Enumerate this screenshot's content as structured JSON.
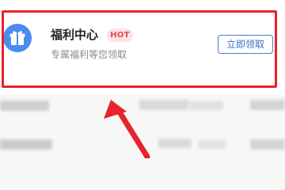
{
  "card": {
    "title": "福利中心",
    "badge": "HOT",
    "subtitle": "专属福利等您领取",
    "button_label": "立即领取",
    "icon": "gift-icon"
  },
  "colors": {
    "highlight_border": "#e8232b",
    "icon_background": "#4a8cf2",
    "badge_background": "#fbe3e4",
    "badge_text": "#e8464d",
    "button_border": "#4a7bd0",
    "button_text": "#3d6fc4",
    "annotation_arrow": "#e8232b"
  }
}
